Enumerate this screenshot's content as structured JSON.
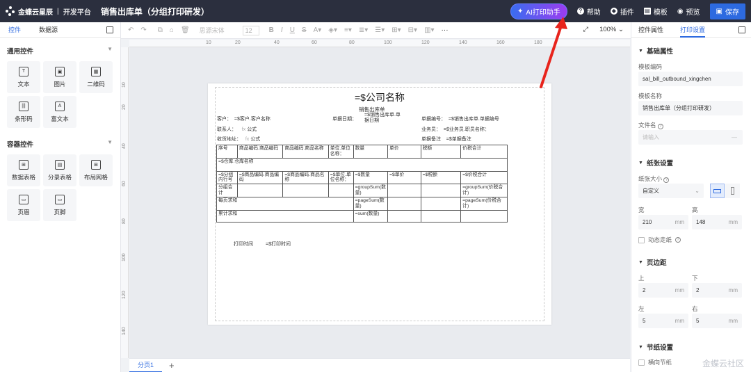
{
  "app": {
    "brand": "金蝶云星辰",
    "platform": "开发平台",
    "doc_title": "销售出库单（分组打印研发）"
  },
  "topbar": {
    "ai_label": "AI打印助手",
    "help": "帮助",
    "plugin": "插件",
    "template": "模板",
    "preview": "预览",
    "save": "保存"
  },
  "left": {
    "tabs": [
      "控件",
      "数据源"
    ],
    "general_title": "通用控件",
    "general": [
      {
        "label": "文本",
        "icon": "T"
      },
      {
        "label": "图片",
        "icon": "▣"
      },
      {
        "label": "二维码",
        "icon": "▦"
      },
      {
        "label": "条形码",
        "icon": "|||"
      },
      {
        "label": "富文本",
        "icon": "A"
      }
    ],
    "container_title": "容器控件",
    "container": [
      {
        "label": "数据表格",
        "icon": "⊞"
      },
      {
        "label": "分录表格",
        "icon": "▤"
      },
      {
        "label": "布局网格",
        "icon": "⊞"
      },
      {
        "label": "页眉",
        "icon": "▭"
      },
      {
        "label": "页脚",
        "icon": "▭"
      }
    ]
  },
  "toolbar": {
    "font": "思源宋体",
    "size": "12",
    "zoom": "100%"
  },
  "ruler": {
    "h": [
      "10",
      "20",
      "40",
      "60",
      "80",
      "100",
      "120",
      "140",
      "160",
      "180"
    ],
    "v": [
      "10",
      "20",
      "40",
      "60",
      "80",
      "100",
      "120",
      "140"
    ]
  },
  "report": {
    "company": "=$公司名称",
    "subtitle": "销售出库单",
    "customer_label": "客户：",
    "customer_value": "=$客户.客户名称",
    "date_label": "单据日期：",
    "date_value": "=$销售出库单.单据日期",
    "billno_label": "单据编号：",
    "billno_value": "=$销售出库单.单据编号",
    "contact_label": "联系人：",
    "formula": "公式",
    "salesman_label": "业务员：",
    "salesman_value": "=$业务员.职员名称：",
    "address_label": "收货地址：",
    "remark_label": "单据备注",
    "remark_value": "=$单据备注",
    "header_row": [
      "序号",
      "商品编码.商品编码",
      "商品编码.商品名称",
      "单位.单位名称：",
      "数量",
      "单价",
      "税额",
      "价税合计"
    ],
    "group_row": "=$仓库.仓库名称",
    "data_row": [
      "=$分组内行号",
      "=$商品编码.商品编码",
      "=$商品编码.商品名称",
      "=$单位.单位名称：",
      "=$数量",
      "=$单价",
      "=$税额",
      "=$价税合计"
    ],
    "subtotal_label": "分组合计",
    "subtotal_qty": "=groupSum(数量)",
    "subtotal_total": "=groupSum(价税合计)",
    "page_label": "每页求和",
    "page_qty": "=pageSum(数量)",
    "page_total": "=pageSum(价税合计)",
    "cum_label": "累计求和",
    "cum_qty": "=sum(数量)",
    "print_time_label": "打印时间",
    "print_time_value": "=$打印时间"
  },
  "pages": {
    "tab": "分页1",
    "add": "+"
  },
  "right": {
    "tabs": [
      "控件属性",
      "打印设置"
    ],
    "basic_title": "基础属性",
    "code_label": "模板编码",
    "code_value": "sal_bill_outbound_xingchen",
    "name_label": "模板名称",
    "name_value": "销售出库单（分组打印研发）",
    "file_label": "文件名",
    "file_placeholder": "请输入",
    "paper_title": "纸张设置",
    "size_label": "纸张大小",
    "size_value": "自定义",
    "width_label": "宽",
    "width_value": "210",
    "height_label": "高",
    "height_value": "148",
    "unit": "mm",
    "dynamic_label": "动态走纸",
    "margin_title": "页边距",
    "top_label": "上",
    "top_value": "2",
    "bottom_label": "下",
    "bottom_value": "2",
    "left_label": "左",
    "left_value": "5",
    "right_label": "右",
    "right_value": "5",
    "fold_title": "节纸设置",
    "fold_label": "横向节纸"
  },
  "watermark": "金蝶云社区",
  "colors": {
    "topbar": "#2b2f3e",
    "accent": "#2d6ae0",
    "arrow": "#e8241c"
  }
}
